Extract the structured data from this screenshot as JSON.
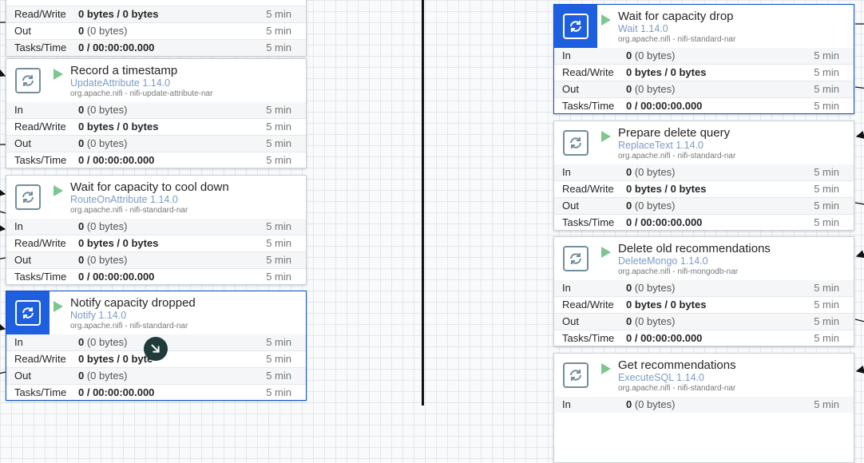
{
  "stat_labels": {
    "in": "In",
    "read_write": "Read/Write",
    "out": "Out",
    "tasks_time": "Tasks/Time"
  },
  "processors": {
    "p0": {
      "read_write": "0 bytes / 0 bytes",
      "read_write_period": "5 min",
      "out_count": "0",
      "out_bytes": " (0 bytes)",
      "out_period": "5 min",
      "tasks_time": "0 / 00:00:00.000",
      "tasks_period": "5 min"
    },
    "p1": {
      "name": "Record a timestamp",
      "type": "UpdateAttribute 1.14.0",
      "bundle": "org.apache.nifi - nifi-update-attribute-nar",
      "in_count": "0",
      "in_bytes": " (0 bytes)",
      "in_period": "5 min",
      "read_write": "0 bytes / 0 bytes",
      "read_write_period": "5 min",
      "out_count": "0",
      "out_bytes": " (0 bytes)",
      "out_period": "5 min",
      "tasks_time": "0 / 00:00:00.000",
      "tasks_period": "5 min"
    },
    "p2": {
      "name": "Wait for capacity to cool down",
      "type": "RouteOnAttribute 1.14.0",
      "bundle": "org.apache.nifi - nifi-standard-nar",
      "in_count": "0",
      "in_bytes": " (0 bytes)",
      "in_period": "5 min",
      "read_write": "0 bytes / 0 bytes",
      "read_write_period": "5 min",
      "out_count": "0",
      "out_bytes": " (0 bytes)",
      "out_period": "5 min",
      "tasks_time": "0 / 00:00:00.000",
      "tasks_period": "5 min"
    },
    "p3": {
      "name": "Notify capacity dropped",
      "type": "Notify 1.14.0",
      "bundle": "org.apache.nifi - nifi-standard-nar",
      "in_count": "0",
      "in_bytes": " (0 bytes)",
      "in_period": "5 min",
      "read_write": "0 bytes / 0 byte",
      "read_write_period": "5 min",
      "out_count": "0",
      "out_bytes": " (0 bytes)",
      "out_period": "5 min",
      "tasks_time": "0 / 00:00:00.000",
      "tasks_period": "5 min"
    },
    "p4": {
      "name": "Wait for capacity drop",
      "type": "Wait 1.14.0",
      "bundle": "org.apache.nifi - nifi-standard-nar",
      "in_count": "0",
      "in_bytes": " (0 bytes)",
      "in_period": "5 min",
      "read_write": "0 bytes / 0 bytes",
      "read_write_period": "5 min",
      "out_count": "0",
      "out_bytes": " (0 bytes)",
      "out_period": "5 min",
      "tasks_time": "0 / 00:00:00.000",
      "tasks_period": "5 min"
    },
    "p5": {
      "name": "Prepare delete query",
      "type": "ReplaceText 1.14.0",
      "bundle": "org.apache.nifi - nifi-standard-nar",
      "in_count": "0",
      "in_bytes": " (0 bytes)",
      "in_period": "5 min",
      "read_write": "0 bytes / 0 bytes",
      "read_write_period": "5 min",
      "out_count": "0",
      "out_bytes": " (0 bytes)",
      "out_period": "5 min",
      "tasks_time": "0 / 00:00:00.000",
      "tasks_period": "5 min"
    },
    "p6": {
      "name": "Delete old recommendations",
      "type": "DeleteMongo 1.14.0",
      "bundle": "org.apache.nifi - nifi-mongodb-nar",
      "in_count": "0",
      "in_bytes": " (0 bytes)",
      "in_period": "5 min",
      "read_write": "0 bytes / 0 bytes",
      "read_write_period": "5 min",
      "out_count": "0",
      "out_bytes": " (0 bytes)",
      "out_period": "5 min",
      "tasks_time": "0 / 00:00:00.000",
      "tasks_period": "5 min"
    },
    "p7": {
      "name": "Get recommendations",
      "type": "ExecuteSQL 1.14.0",
      "bundle": "org.apache.nifi - nifi-standard-nar",
      "in_count": "0",
      "in_bytes": " (0 bytes)",
      "in_period": "5 min"
    }
  },
  "icons": {
    "processor": "processor-icon",
    "run": "run-status-icon",
    "cursor": "drag-cursor-icon"
  },
  "colors": {
    "selected_accent": "#1e5fe0",
    "running_green": "#7dc78f",
    "type_link": "#7a9cc4"
  }
}
